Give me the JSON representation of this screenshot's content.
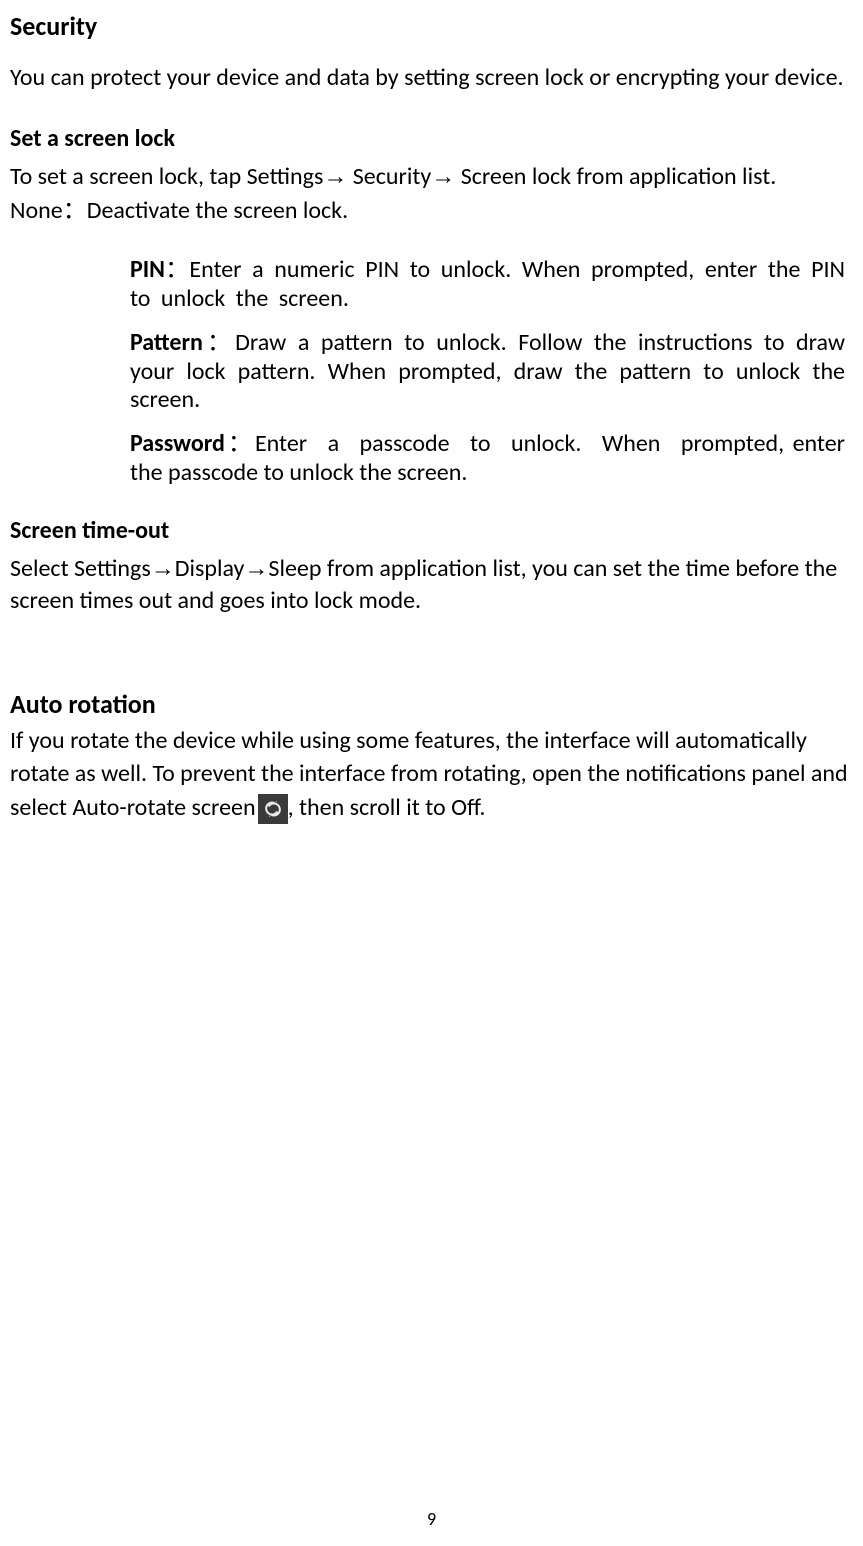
{
  "security": {
    "title": "Security",
    "intro": "You can protect your device and data by setting screen lock or encrypting your device.",
    "screenLock": {
      "heading": "Set a screen lock",
      "instruction_prefix": "To set a screen lock, tap Settings",
      "path_security": " Security",
      "path_screenlock": " Screen lock from application list.",
      "none_label": "None",
      "none_desc": "Deactivate the screen lock.",
      "items": {
        "pin_label": "PIN",
        "pin_desc": "Enter a numeric PIN to unlock. When prompted, enter the PIN to unlock the screen.",
        "pattern_label": "Pattern",
        "pattern_desc": "Draw a pattern to unlock. Follow the instructions to draw your lock pattern. When prompted, draw the pattern to unlock the screen.",
        "password_label": "Password",
        "password_desc_line1": "Enter a passcode to unlock. When prompted,",
        "password_desc_line2": "enter the passcode to unlock the screen."
      }
    },
    "timeout": {
      "heading": "Screen time-out",
      "prefix": "Select Settings",
      "path_display": "Display",
      "path_sleep": "Sleep from application list, you can set the time before the screen times out and goes into lock mode."
    }
  },
  "autoRotation": {
    "title": "Auto rotation",
    "text_part1": "If you rotate the device while using some features, the interface will automatically rotate as well. To prevent the interface from rotating, open the notifications panel and select Auto-rotate screen",
    "text_part2": ", then scroll it to Off."
  },
  "pageNumber": "9"
}
